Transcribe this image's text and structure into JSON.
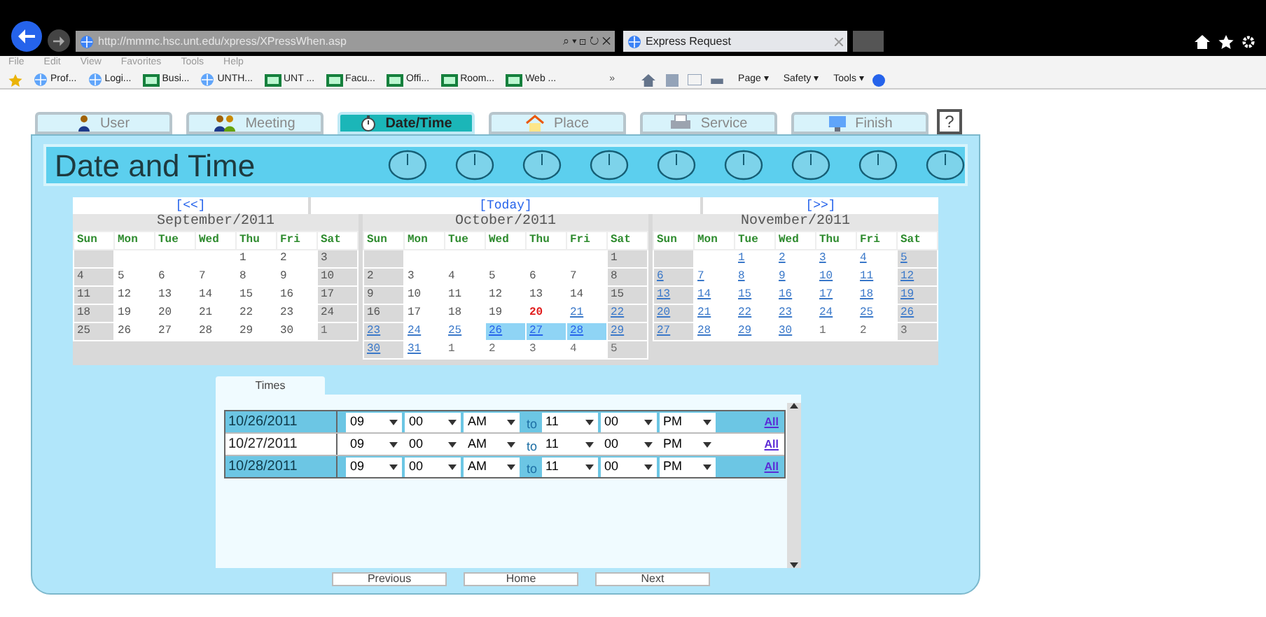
{
  "browser": {
    "address": "http://mmmc.hsc.unt.edu/xpress/XPressWhen.asp",
    "address_controls": "⌕ ▾ ⊡ ↻ ✕",
    "tab_title": "Express Request",
    "menu": [
      "File",
      "Edit",
      "View",
      "Favorites",
      "Tools",
      "Help"
    ],
    "favorites": [
      {
        "label": "Prof...",
        "kind": "page"
      },
      {
        "label": "Logi...",
        "kind": "page"
      },
      {
        "label": "Busi...",
        "kind": "site"
      },
      {
        "label": "UNTH...",
        "kind": "page"
      },
      {
        "label": "UNT ...",
        "kind": "site"
      },
      {
        "label": "Facu...",
        "kind": "site"
      },
      {
        "label": "Offi...",
        "kind": "site"
      },
      {
        "label": "Room...",
        "kind": "site"
      },
      {
        "label": "Web ...",
        "kind": "site"
      }
    ],
    "overflow": "»",
    "commands": [
      "Page ▾",
      "Safety ▾",
      "Tools ▾"
    ]
  },
  "tabs": [
    {
      "label": "User",
      "selected": false
    },
    {
      "label": "Meeting",
      "selected": false
    },
    {
      "label": "Date/Time",
      "selected": true
    },
    {
      "label": "Place",
      "selected": false
    },
    {
      "label": "Service",
      "selected": false
    },
    {
      "label": "Finish",
      "selected": false
    }
  ],
  "help": "?",
  "heading": "Date and Time",
  "nav": {
    "prev": "[<<]",
    "today": "[Today]",
    "next": "[>>]"
  },
  "months": [
    {
      "title": "September/2011",
      "weekdays": [
        "Sun",
        "Mon",
        "Tue",
        "Wed",
        "Thu",
        "Fri",
        "Sat"
      ],
      "weeks": [
        [
          {
            "kind": "empty"
          },
          {
            "kind": "empty"
          },
          {
            "kind": "empty"
          },
          {
            "kind": "empty"
          },
          {
            "text": "1",
            "kind": "past"
          },
          {
            "text": "2",
            "kind": "past"
          },
          {
            "text": "3",
            "kind": "past"
          }
        ],
        [
          {
            "text": "4",
            "kind": "past"
          },
          {
            "text": "5",
            "kind": "past"
          },
          {
            "text": "6",
            "kind": "past"
          },
          {
            "text": "7",
            "kind": "past"
          },
          {
            "text": "8",
            "kind": "past"
          },
          {
            "text": "9",
            "kind": "past"
          },
          {
            "text": "10",
            "kind": "past"
          }
        ],
        [
          {
            "text": "11",
            "kind": "past"
          },
          {
            "text": "12",
            "kind": "past"
          },
          {
            "text": "13",
            "kind": "past"
          },
          {
            "text": "14",
            "kind": "past"
          },
          {
            "text": "15",
            "kind": "past"
          },
          {
            "text": "16",
            "kind": "past"
          },
          {
            "text": "17",
            "kind": "past"
          }
        ],
        [
          {
            "text": "18",
            "kind": "past"
          },
          {
            "text": "19",
            "kind": "past"
          },
          {
            "text": "20",
            "kind": "past"
          },
          {
            "text": "21",
            "kind": "past"
          },
          {
            "text": "22",
            "kind": "past"
          },
          {
            "text": "23",
            "kind": "past"
          },
          {
            "text": "24",
            "kind": "past"
          }
        ],
        [
          {
            "text": "25",
            "kind": "past"
          },
          {
            "text": "26",
            "kind": "past"
          },
          {
            "text": "27",
            "kind": "past"
          },
          {
            "text": "28",
            "kind": "past"
          },
          {
            "text": "29",
            "kind": "past"
          },
          {
            "text": "30",
            "kind": "past"
          },
          {
            "text": "1",
            "kind": "outside"
          }
        ]
      ]
    },
    {
      "title": "October/2011",
      "weekdays": [
        "Sun",
        "Mon",
        "Tue",
        "Wed",
        "Thu",
        "Fri",
        "Sat"
      ],
      "weeks": [
        [
          {
            "kind": "empty"
          },
          {
            "kind": "empty"
          },
          {
            "kind": "empty"
          },
          {
            "kind": "empty"
          },
          {
            "kind": "empty"
          },
          {
            "kind": "empty"
          },
          {
            "text": "1",
            "kind": "past"
          }
        ],
        [
          {
            "text": "2",
            "kind": "past"
          },
          {
            "text": "3",
            "kind": "past"
          },
          {
            "text": "4",
            "kind": "past"
          },
          {
            "text": "5",
            "kind": "past"
          },
          {
            "text": "6",
            "kind": "past"
          },
          {
            "text": "7",
            "kind": "past"
          },
          {
            "text": "8",
            "kind": "past"
          }
        ],
        [
          {
            "text": "9",
            "kind": "past"
          },
          {
            "text": "10",
            "kind": "past"
          },
          {
            "text": "11",
            "kind": "past"
          },
          {
            "text": "12",
            "kind": "past"
          },
          {
            "text": "13",
            "kind": "past"
          },
          {
            "text": "14",
            "kind": "past"
          },
          {
            "text": "15",
            "kind": "past"
          }
        ],
        [
          {
            "text": "16",
            "kind": "past"
          },
          {
            "text": "17",
            "kind": "past"
          },
          {
            "text": "18",
            "kind": "past"
          },
          {
            "text": "19",
            "kind": "past"
          },
          {
            "text": "20",
            "kind": "today"
          },
          {
            "text": "21",
            "kind": "future"
          },
          {
            "text": "22",
            "kind": "future"
          }
        ],
        [
          {
            "text": "23",
            "kind": "future"
          },
          {
            "text": "24",
            "kind": "future"
          },
          {
            "text": "25",
            "kind": "future"
          },
          {
            "text": "26",
            "kind": "selected"
          },
          {
            "text": "27",
            "kind": "selected"
          },
          {
            "text": "28",
            "kind": "selected"
          },
          {
            "text": "29",
            "kind": "future"
          }
        ],
        [
          {
            "text": "30",
            "kind": "future"
          },
          {
            "text": "31",
            "kind": "future"
          },
          {
            "text": "1",
            "kind": "outside"
          },
          {
            "text": "2",
            "kind": "outside"
          },
          {
            "text": "3",
            "kind": "outside"
          },
          {
            "text": "4",
            "kind": "outside"
          },
          {
            "text": "5",
            "kind": "outside"
          }
        ]
      ]
    },
    {
      "title": "November/2011",
      "weekdays": [
        "Sun",
        "Mon",
        "Tue",
        "Wed",
        "Thu",
        "Fri",
        "Sat"
      ],
      "weeks": [
        [
          {
            "kind": "empty"
          },
          {
            "kind": "empty"
          },
          {
            "text": "1",
            "kind": "future"
          },
          {
            "text": "2",
            "kind": "future"
          },
          {
            "text": "3",
            "kind": "future"
          },
          {
            "text": "4",
            "kind": "future"
          },
          {
            "text": "5",
            "kind": "future"
          }
        ],
        [
          {
            "text": "6",
            "kind": "future"
          },
          {
            "text": "7",
            "kind": "future"
          },
          {
            "text": "8",
            "kind": "future"
          },
          {
            "text": "9",
            "kind": "future"
          },
          {
            "text": "10",
            "kind": "future"
          },
          {
            "text": "11",
            "kind": "future"
          },
          {
            "text": "12",
            "kind": "future"
          }
        ],
        [
          {
            "text": "13",
            "kind": "future"
          },
          {
            "text": "14",
            "kind": "future"
          },
          {
            "text": "15",
            "kind": "future"
          },
          {
            "text": "16",
            "kind": "future"
          },
          {
            "text": "17",
            "kind": "future"
          },
          {
            "text": "18",
            "kind": "future"
          },
          {
            "text": "19",
            "kind": "future"
          }
        ],
        [
          {
            "text": "20",
            "kind": "future"
          },
          {
            "text": "21",
            "kind": "future"
          },
          {
            "text": "22",
            "kind": "future"
          },
          {
            "text": "23",
            "kind": "future"
          },
          {
            "text": "24",
            "kind": "future"
          },
          {
            "text": "25",
            "kind": "future"
          },
          {
            "text": "26",
            "kind": "future"
          }
        ],
        [
          {
            "text": "27",
            "kind": "future"
          },
          {
            "text": "28",
            "kind": "future"
          },
          {
            "text": "29",
            "kind": "future"
          },
          {
            "text": "30",
            "kind": "future"
          },
          {
            "text": "1",
            "kind": "outside"
          },
          {
            "text": "2",
            "kind": "outside"
          },
          {
            "text": "3",
            "kind": "outside"
          }
        ]
      ]
    }
  ],
  "times": {
    "tab": "Times",
    "rows": [
      {
        "date": "10/26/2011",
        "highlighted": true,
        "start": [
          "09",
          "00",
          "AM"
        ],
        "to": "to",
        "end": [
          "11",
          "00",
          "PM"
        ],
        "link": "All"
      },
      {
        "date": "10/27/2011",
        "highlighted": false,
        "start": [
          "09",
          "00",
          "AM"
        ],
        "to": "to",
        "end": [
          "11",
          "00",
          "PM"
        ],
        "link": "All"
      },
      {
        "date": "10/28/2011",
        "highlighted": true,
        "start": [
          "09",
          "00",
          "AM"
        ],
        "to": "to",
        "end": [
          "11",
          "00",
          "PM"
        ],
        "link": "All"
      }
    ]
  },
  "buttons": [
    "Previous",
    "Home",
    "Next"
  ]
}
